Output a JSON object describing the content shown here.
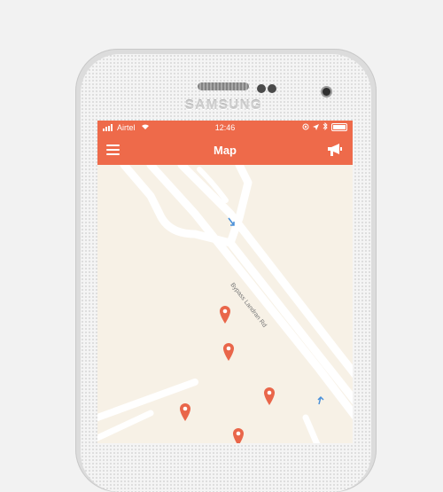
{
  "device": {
    "brand": "SAMSUNG"
  },
  "status_bar": {
    "carrier": "Airtel",
    "time": "12:46",
    "icons": [
      "signal-icon",
      "wifi-icon",
      "location-icon",
      "navigation-arrow-icon",
      "bluetooth-icon",
      "battery-icon"
    ]
  },
  "app_bar": {
    "title": "Map",
    "menu_icon": "hamburger-menu-icon",
    "action_icon": "megaphone-icon"
  },
  "map": {
    "road_label": "Bypass Landran Rd",
    "pin_count": 5,
    "colors": {
      "land": "#f7f1e6",
      "road": "#ffffff",
      "pin": "#e9664a",
      "accent": "#ee6a4a",
      "arrow": "#4a90d9"
    }
  }
}
